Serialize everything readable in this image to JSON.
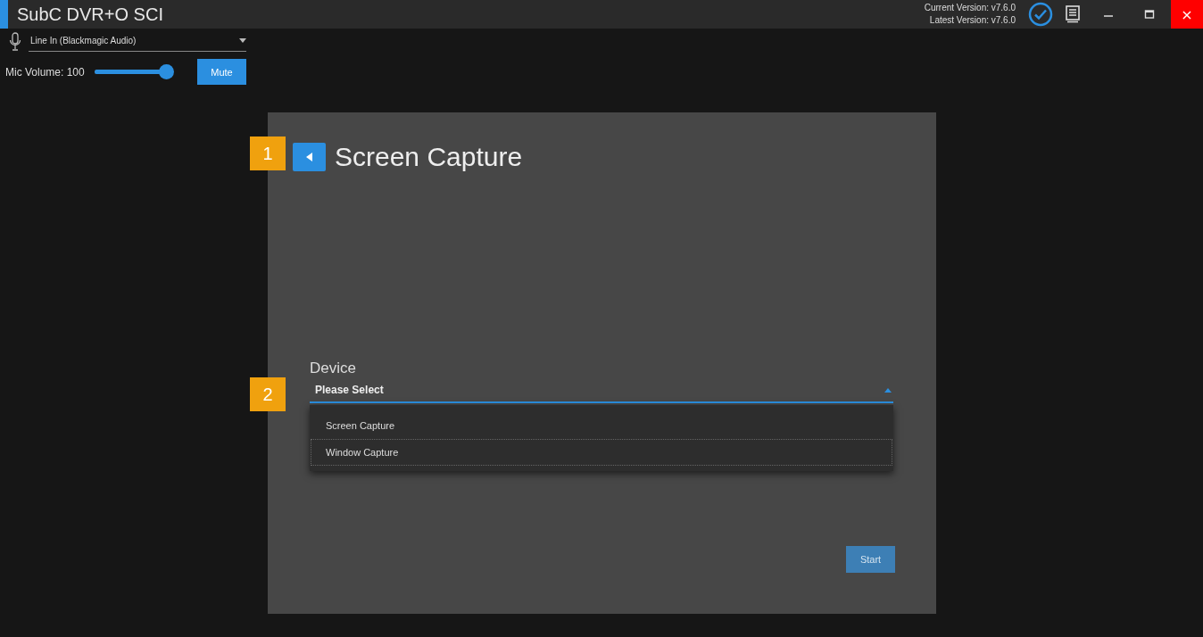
{
  "window": {
    "title": "SubC DVR+O SCI",
    "current_version": "Current Version: v7.6.0",
    "latest_version": "Latest Version: v7.6.0",
    "close": "×"
  },
  "audio": {
    "input": "Line In (Blackmagic Audio)",
    "volume_label": "Mic Volume: 100",
    "level": 1.0,
    "mute_button": "Mute"
  },
  "panel": {
    "title": "Screen Capture",
    "step_badges": [
      "1",
      "2"
    ],
    "device": {
      "label": "Device",
      "value": "Please Select",
      "expanded": true,
      "options": [
        {
          "label": "Screen Capture",
          "selected": false
        },
        {
          "label": "Window Capture",
          "selected": true
        }
      ]
    },
    "start_button": {
      "label": "Start",
      "disabled": true
    }
  }
}
